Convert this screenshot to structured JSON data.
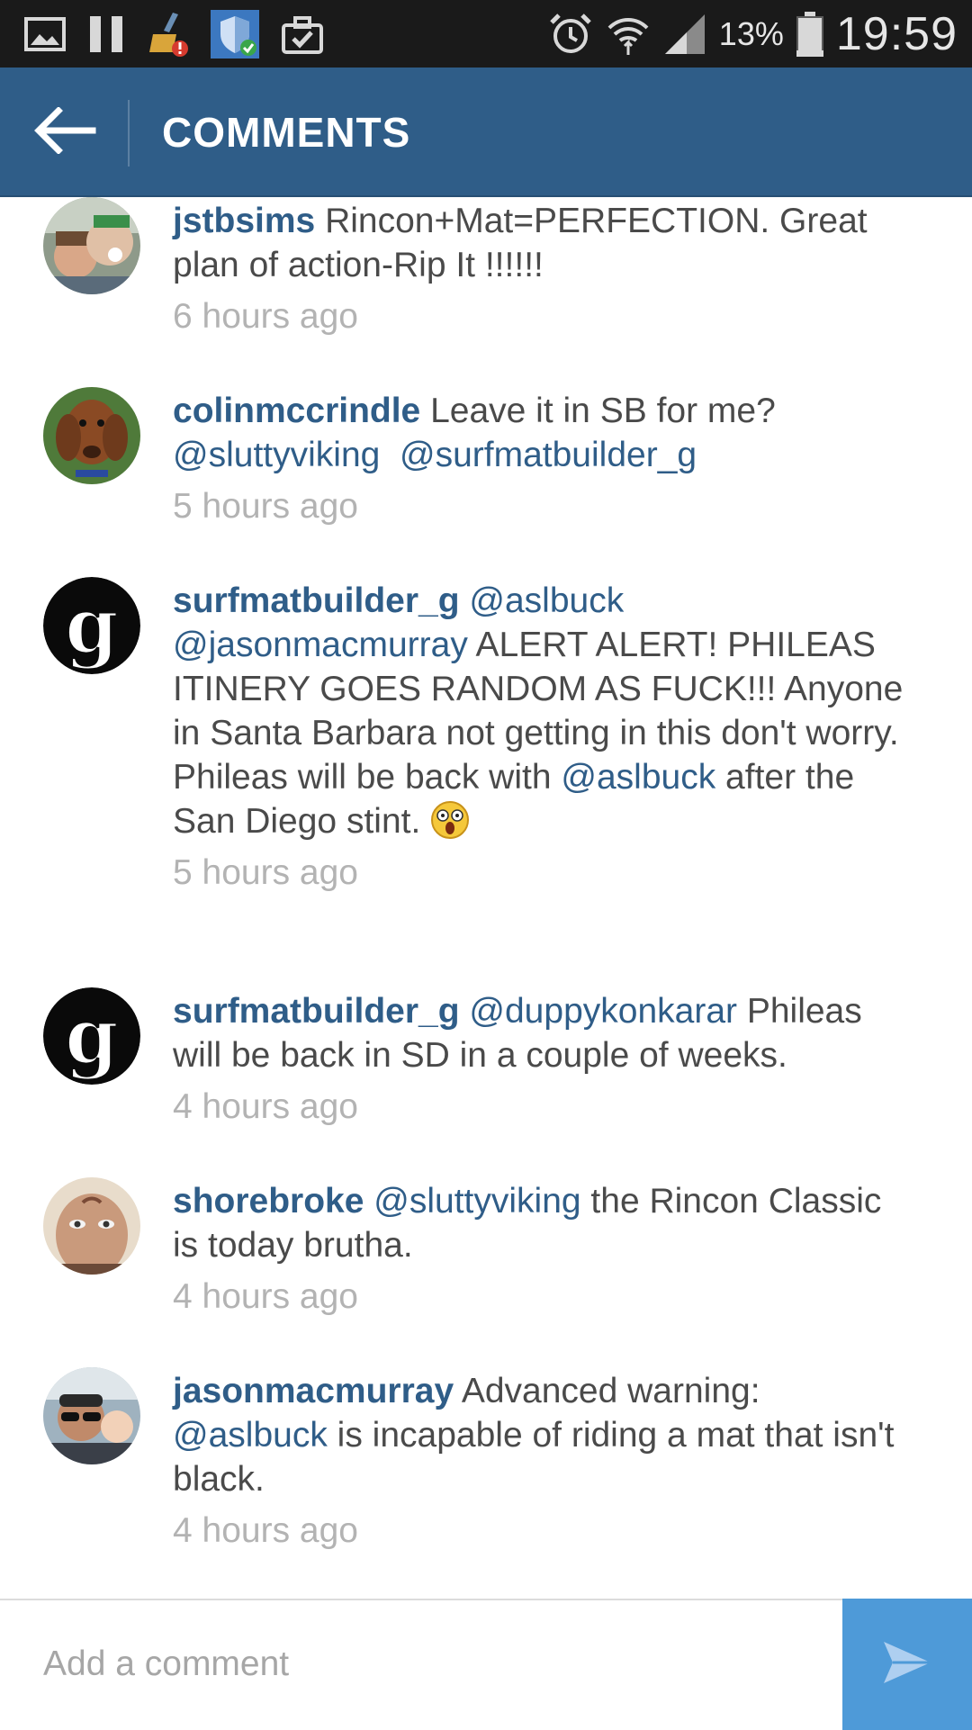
{
  "status_bar": {
    "battery_percent": "13%",
    "time": "19:59",
    "left_icons": [
      "image-icon",
      "pause-icon",
      "broom-icon",
      "shield-icon",
      "briefcase-check-icon"
    ],
    "right_icons": [
      "alarm-icon",
      "wifi-icon",
      "signal-icon",
      "battery-icon"
    ]
  },
  "header": {
    "title": "COMMENTS",
    "back_icon": "back-arrow-icon",
    "color": "#2f5d88"
  },
  "comments": [
    {
      "username": "jstbsims",
      "segments": [
        {
          "t": "text",
          "v": " Rincon+Mat=PERFECTION. Great plan of action-Rip It !!!!!!"
        }
      ],
      "time": "6 hours ago"
    },
    {
      "username": "colinmccrindle",
      "segments": [
        {
          "t": "text",
          "v": " Leave it in SB for me? "
        },
        {
          "t": "mention",
          "v": "@sluttyviking"
        },
        {
          "t": "text",
          "v": "  "
        },
        {
          "t": "mention",
          "v": "@surfmatbuilder_g"
        }
      ],
      "time": "5 hours ago"
    },
    {
      "username": "surfmatbuilder_g",
      "segments": [
        {
          "t": "text",
          "v": " "
        },
        {
          "t": "mention",
          "v": "@aslbuck"
        },
        {
          "t": "text",
          "v": " "
        },
        {
          "t": "mention",
          "v": "@jasonmacmurray"
        },
        {
          "t": "text",
          "v": " ALERT ALERT! PHILEAS ITINERY GOES RANDOM AS FUCK!!! Anyone in Santa Barbara not getting in this don't worry. Phileas will be back with "
        },
        {
          "t": "mention",
          "v": "@aslbuck"
        },
        {
          "t": "text",
          "v": " after the San Diego stint. "
        },
        {
          "t": "emoji",
          "v": "astonished-face-emoji"
        }
      ],
      "time": "5 hours ago"
    },
    {
      "username": "surfmatbuilder_g",
      "segments": [
        {
          "t": "text",
          "v": " "
        },
        {
          "t": "mention",
          "v": "@duppykonkarar"
        },
        {
          "t": "text",
          "v": " Phileas will be back in SD in a couple of weeks."
        }
      ],
      "time": "4 hours ago"
    },
    {
      "username": "shorebroke",
      "segments": [
        {
          "t": "text",
          "v": " "
        },
        {
          "t": "mention",
          "v": "@sluttyviking"
        },
        {
          "t": "text",
          "v": " the Rincon Classic is today brutha."
        }
      ],
      "time": "4 hours ago"
    },
    {
      "username": "jasonmacmurray",
      "segments": [
        {
          "t": "text",
          "v": " Advanced warning: "
        },
        {
          "t": "mention",
          "v": "@aslbuck"
        },
        {
          "t": "text",
          "v": " is incapable of riding a mat that isn't black."
        }
      ],
      "time": "4 hours ago"
    }
  ],
  "input": {
    "placeholder": "Add a comment",
    "send_icon": "send-icon",
    "send_color": "#4e9ad8"
  }
}
